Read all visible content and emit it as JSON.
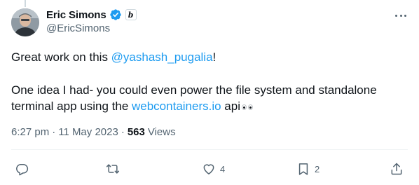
{
  "author": {
    "name": "Eric Simons",
    "handle": "@EricSimons",
    "affiliate_badge": "b",
    "avatar_icon": "avatar",
    "verified_icon": "verified-badge-icon"
  },
  "tweet": {
    "line1_prefix": "Great work on this ",
    "line1_mention": "@yashash_pugalia",
    "line1_suffix": "!",
    "line2_prefix": "One idea I had- you could even power the file system and standalone terminal app using the ",
    "line2_link": "webcontainers.io",
    "line2_suffix": " api",
    "emoji": "eyes"
  },
  "meta": {
    "time": "6:27 pm",
    "separator1": "·",
    "date": "11 May 2023",
    "separator2": "·",
    "views_count": "563",
    "views_label": "Views"
  },
  "actions": {
    "reply": {
      "icon": "reply-icon",
      "count": ""
    },
    "retweet": {
      "icon": "retweet-icon",
      "count": ""
    },
    "like": {
      "icon": "heart-icon",
      "count": "4"
    },
    "bookmark": {
      "icon": "bookmark-icon",
      "count": "2"
    },
    "share": {
      "icon": "share-icon",
      "count": ""
    }
  },
  "colors": {
    "text": "#0f1419",
    "secondary": "#536471",
    "link": "#1d9bf0",
    "divider": "#eff3f4"
  }
}
